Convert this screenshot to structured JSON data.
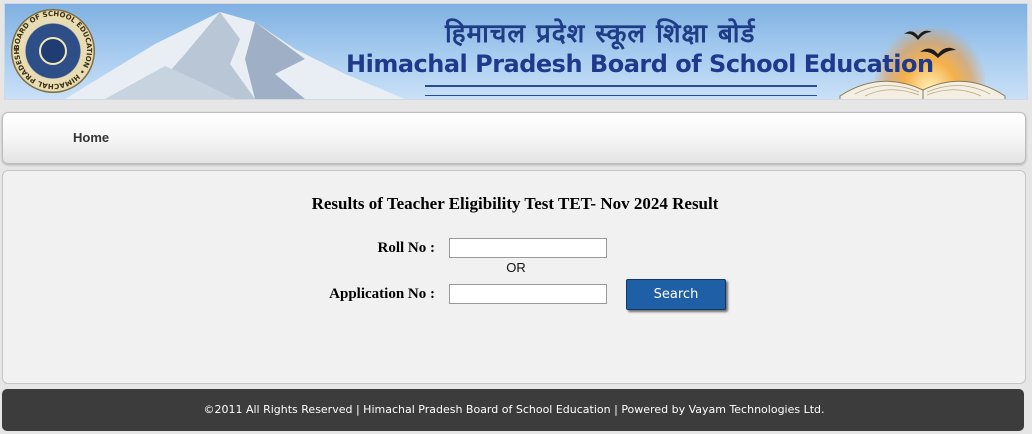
{
  "banner": {
    "title_hindi": "हिमाचल प्रदेश स्कूल शिक्षा बोर्ड",
    "title_english": "Himachal Pradesh Board of School Education",
    "logo_ring_text": "BOARD OF SCHOOL EDUCATION • HIMACHAL PRADESH"
  },
  "nav": {
    "home_label": "Home"
  },
  "form": {
    "title": "Results of Teacher Eligibility Test TET- Nov 2024 Result",
    "roll_label": "Roll No :",
    "roll_value": "",
    "or_label": "OR",
    "application_label": "Application No :",
    "application_value": "",
    "search_label": "Search"
  },
  "footer": {
    "text": "©2011 All Rights Reserved | Himachal Pradesh Board of School Education | Powered by Vayam Technologies Ltd."
  },
  "colors": {
    "banner_title": "#1d3a8c",
    "search_button": "#1f5fa6",
    "footer_bg": "#3c3c3c"
  },
  "icons": {
    "logo": "board-emblem-icon",
    "birds": "birds-icon",
    "book": "open-book-icon"
  }
}
